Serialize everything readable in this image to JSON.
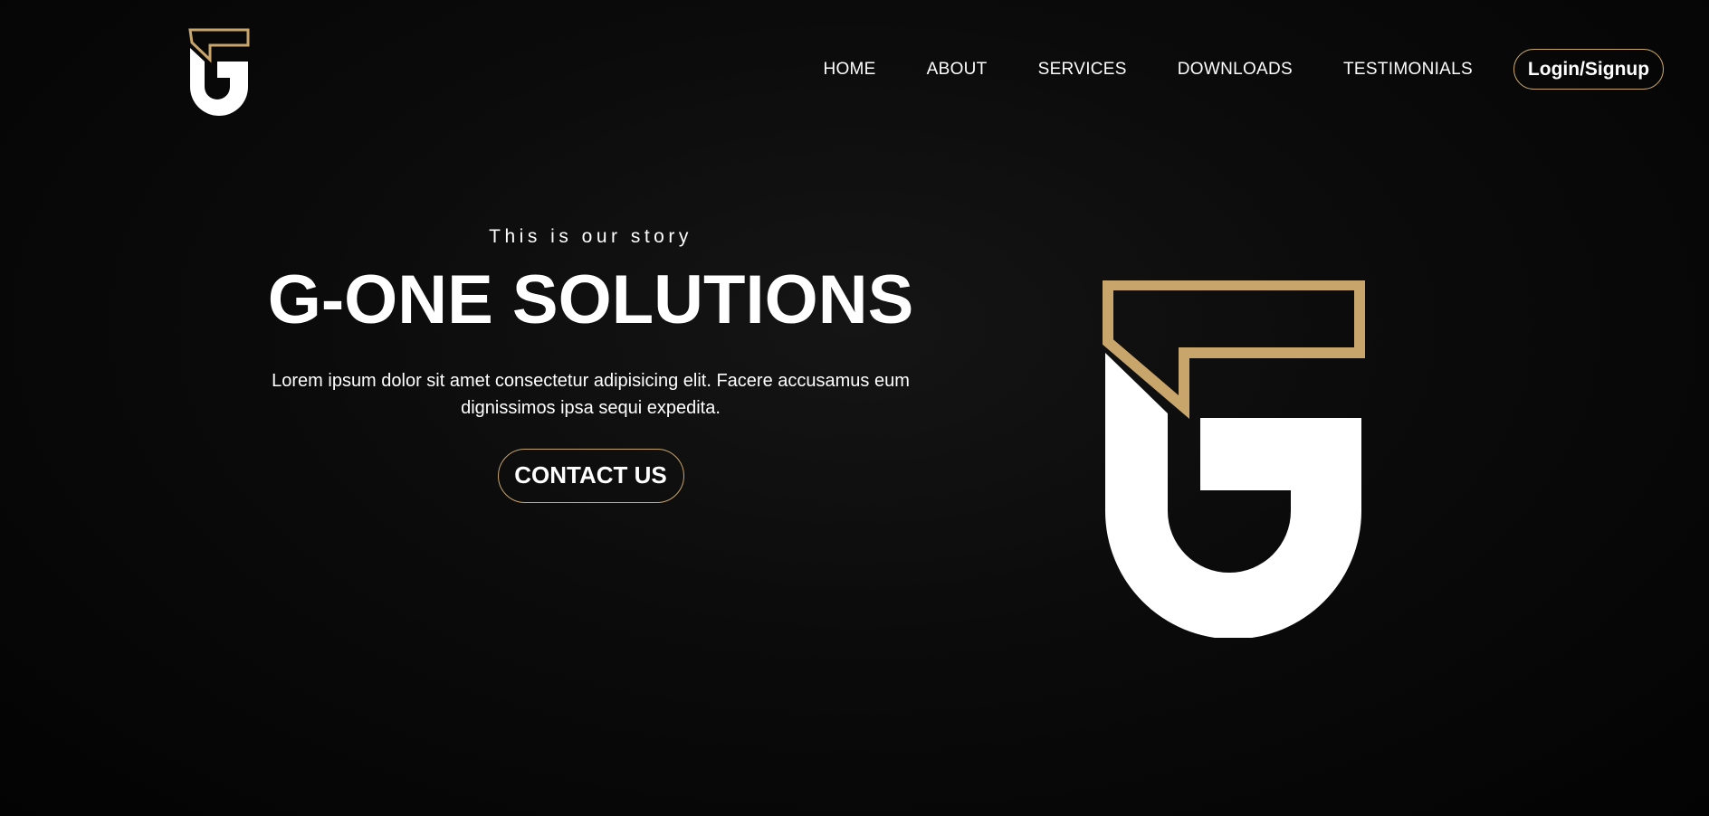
{
  "brand": {
    "logo_icon": "g-one-logo-icon",
    "accent_color": "#c8a56a",
    "logo_white": "#ffffff"
  },
  "nav": {
    "items": [
      {
        "label": "HOME"
      },
      {
        "label": "ABOUT"
      },
      {
        "label": "SERVICES"
      },
      {
        "label": "DOWNLOADS"
      },
      {
        "label": "TESTIMONIALS"
      }
    ],
    "login_label": "Login/Signup"
  },
  "hero": {
    "eyebrow": "This is our story",
    "title": "G-ONE SOLUTIONS",
    "description": "Lorem ipsum dolor sit amet consectetur adipisicing elit. Facere accusamus eum dignissimos ipsa sequi expedita.",
    "cta_label": "CONTACT US"
  }
}
